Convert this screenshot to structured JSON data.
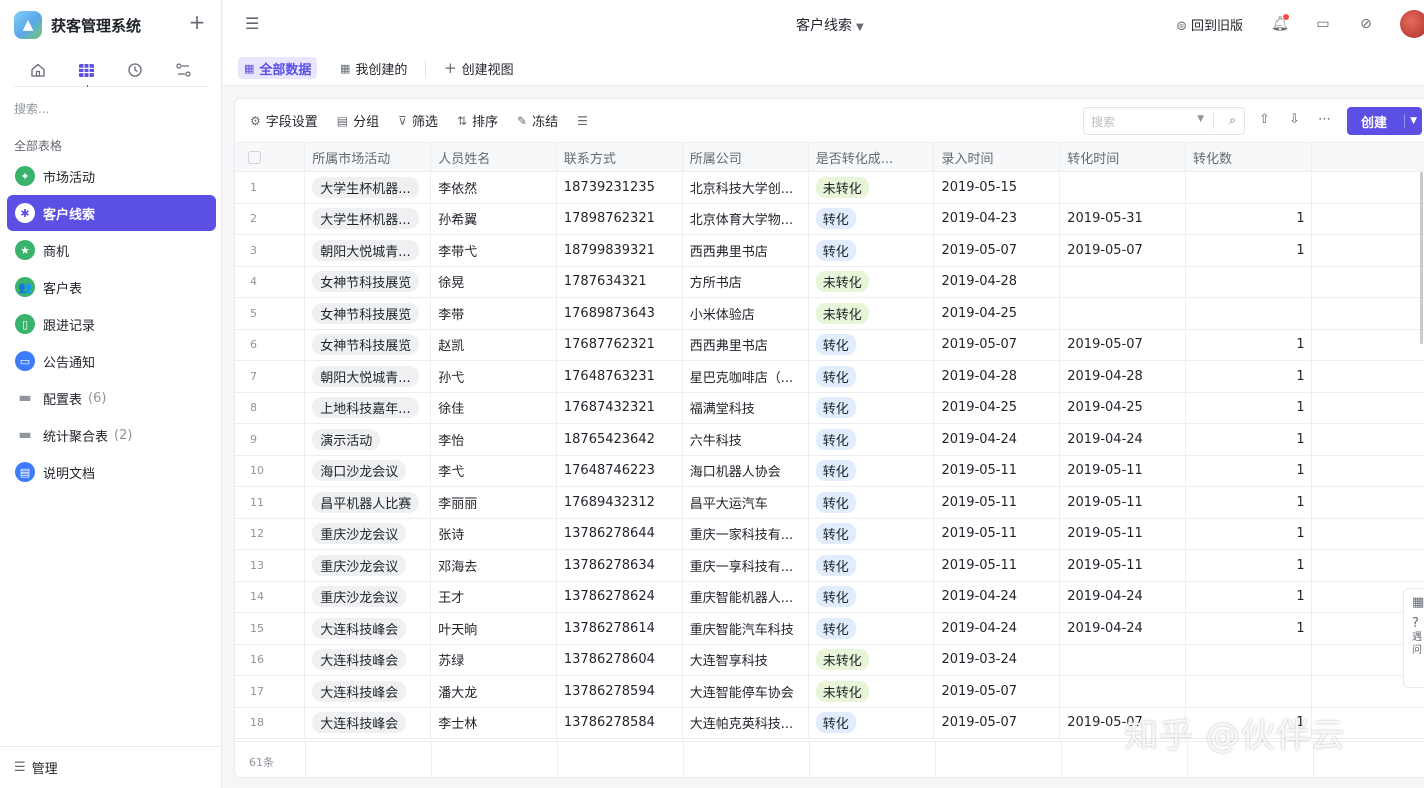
{
  "app": {
    "name": "获客管理系统",
    "search_placeholder": "搜索...",
    "section_label": "全部表格",
    "nav": [
      {
        "label": "市场活动",
        "icon": "running-person-icon",
        "count": ""
      },
      {
        "label": "客户线索",
        "icon": "bug-icon",
        "count": "",
        "active": true
      },
      {
        "label": "商机",
        "icon": "star-icon",
        "count": ""
      },
      {
        "label": "客户表",
        "icon": "people-icon",
        "count": ""
      },
      {
        "label": "跟进记录",
        "icon": "tablet-icon",
        "count": ""
      },
      {
        "label": "公告通知",
        "icon": "chat-icon",
        "count": ""
      },
      {
        "label": "配置表",
        "icon": "folder-icon",
        "count": "(6)"
      },
      {
        "label": "统计聚合表",
        "icon": "folder-icon",
        "count": "(2)"
      },
      {
        "label": "说明文档",
        "icon": "document-icon",
        "count": ""
      }
    ],
    "manage_label": "管理"
  },
  "header": {
    "title": "客户线索",
    "legacy_label": "回到旧版"
  },
  "views": {
    "all": "全部数据",
    "mine": "我创建的",
    "create": "创建视图"
  },
  "toolbar": {
    "field_settings": "字段设置",
    "group": "分组",
    "filter": "筛选",
    "sort": "排序",
    "freeze": "冻结",
    "search_placeholder": "搜索",
    "create": "创建"
  },
  "table": {
    "columns": [
      "所属市场活动",
      "人员姓名",
      "联系方式",
      "所属公司",
      "是否转化成...",
      "录入时间",
      "转化时间",
      "转化数"
    ],
    "rows": [
      {
        "n": "1",
        "activity": "大学生杯机器...",
        "name": "李依然",
        "phone": "18739231235",
        "company": "北京科技大学创...",
        "status": "未转化",
        "entry": "2019-05-15",
        "conv": "",
        "count": ""
      },
      {
        "n": "2",
        "activity": "大学生杯机器...",
        "name": "孙希翼",
        "phone": "17898762321",
        "company": "北京体育大学物...",
        "status": "转化",
        "entry": "2019-04-23",
        "conv": "2019-05-31",
        "count": "1"
      },
      {
        "n": "3",
        "activity": "朝阳大悦城青...",
        "name": "李带弋",
        "phone": "18799839321",
        "company": "西西弗里书店",
        "status": "转化",
        "entry": "2019-05-07",
        "conv": "2019-05-07",
        "count": "1"
      },
      {
        "n": "4",
        "activity": "女神节科技展览",
        "name": "徐晃",
        "phone": "1787634321",
        "company": "方所书店",
        "status": "未转化",
        "entry": "2019-04-28",
        "conv": "",
        "count": ""
      },
      {
        "n": "5",
        "activity": "女神节科技展览",
        "name": "李带",
        "phone": "17689873643",
        "company": "小米体验店",
        "status": "未转化",
        "entry": "2019-04-25",
        "conv": "",
        "count": ""
      },
      {
        "n": "6",
        "activity": "女神节科技展览",
        "name": "赵凯",
        "phone": "17687762321",
        "company": "西西弗里书店",
        "status": "转化",
        "entry": "2019-05-07",
        "conv": "2019-05-07",
        "count": "1"
      },
      {
        "n": "7",
        "activity": "朝阳大悦城青...",
        "name": "孙弋",
        "phone": "17648763231",
        "company": "星巴克咖啡店（...",
        "status": "转化",
        "entry": "2019-04-28",
        "conv": "2019-04-28",
        "count": "1"
      },
      {
        "n": "8",
        "activity": "上地科技嘉年...",
        "name": "徐佳",
        "phone": "17687432321",
        "company": "福满堂科技",
        "status": "转化",
        "entry": "2019-04-25",
        "conv": "2019-04-25",
        "count": "1"
      },
      {
        "n": "9",
        "activity": "演示活动",
        "name": "李怡",
        "phone": "18765423642",
        "company": "六牛科技",
        "status": "转化",
        "entry": "2019-04-24",
        "conv": "2019-04-24",
        "count": "1"
      },
      {
        "n": "10",
        "activity": "海口沙龙会议",
        "name": "李弋",
        "phone": "17648746223",
        "company": "海口机器人协会",
        "status": "转化",
        "entry": "2019-05-11",
        "conv": "2019-05-11",
        "count": "1"
      },
      {
        "n": "11",
        "activity": "昌平机器人比赛",
        "name": "李丽丽",
        "phone": "17689432312",
        "company": "昌平大运汽车",
        "status": "转化",
        "entry": "2019-05-11",
        "conv": "2019-05-11",
        "count": "1"
      },
      {
        "n": "12",
        "activity": "重庆沙龙会议",
        "name": "张诗",
        "phone": "13786278644",
        "company": "重庆一家科技有...",
        "status": "转化",
        "entry": "2019-05-11",
        "conv": "2019-05-11",
        "count": "1"
      },
      {
        "n": "13",
        "activity": "重庆沙龙会议",
        "name": "邓海去",
        "phone": "13786278634",
        "company": "重庆一享科技有...",
        "status": "转化",
        "entry": "2019-05-11",
        "conv": "2019-05-11",
        "count": "1"
      },
      {
        "n": "14",
        "activity": "重庆沙龙会议",
        "name": "王才",
        "phone": "13786278624",
        "company": "重庆智能机器人...",
        "status": "转化",
        "entry": "2019-04-24",
        "conv": "2019-04-24",
        "count": "1"
      },
      {
        "n": "15",
        "activity": "大连科技峰会",
        "name": "叶天晌",
        "phone": "13786278614",
        "company": "重庆智能汽车科技",
        "status": "转化",
        "entry": "2019-04-24",
        "conv": "2019-04-24",
        "count": "1"
      },
      {
        "n": "16",
        "activity": "大连科技峰会",
        "name": "苏绿",
        "phone": "13786278604",
        "company": "大连智享科技",
        "status": "未转化",
        "entry": "2019-03-24",
        "conv": "",
        "count": ""
      },
      {
        "n": "17",
        "activity": "大连科技峰会",
        "name": "潘大龙",
        "phone": "13786278594",
        "company": "大连智能停车协会",
        "status": "未转化",
        "entry": "2019-05-07",
        "conv": "",
        "count": ""
      },
      {
        "n": "18",
        "activity": "大连科技峰会",
        "name": "李士林",
        "phone": "13786278584",
        "company": "大连帕克英科技...",
        "status": "转化",
        "entry": "2019-05-07",
        "conv": "2019-05-07",
        "count": "1"
      }
    ],
    "total": "61条"
  },
  "float_panel": {
    "line1": "遇",
    "line2": "问"
  },
  "watermark": "知乎 @伙伴云"
}
